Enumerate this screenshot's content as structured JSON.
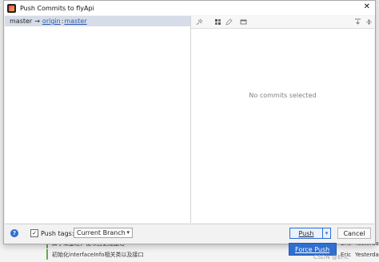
{
  "dialog": {
    "title": "Push Commits to flyApi",
    "close_glyph": "✕"
  },
  "branch_row": {
    "local": "master",
    "arrow": "→",
    "remote": "origin",
    "separator": ":",
    "remote_branch": "master"
  },
  "right_pane": {
    "empty_text": "No commits selected",
    "toolbar_icons": [
      "pin-icon",
      "group-icon",
      "edit-icon",
      "window-icon",
      "expand-icon",
      "collapse-icon"
    ]
  },
  "bottom": {
    "help_glyph": "?",
    "push_tags_label": "Push tags:",
    "push_tags_checked": true,
    "branch_select_value": "Current Branch",
    "push_label": "Push",
    "cancel_label": "Cancel"
  },
  "menu": {
    "force_push": "Force Push"
  },
  "background": {
    "commit_rows": [
      {
        "message": "脚手架整理，使项目更加整洁",
        "author": "Eric",
        "date": "Yesterday"
      },
      {
        "message": "初始化interfaceInfo相关类以及接口",
        "author": "Eric",
        "date": "Yesterday"
      }
    ],
    "watermark": "CSDN @Eric"
  },
  "colors": {
    "accent": "#2d6ed6",
    "selection": "#d6dde8",
    "menu_bg": "#2f6fd1"
  }
}
